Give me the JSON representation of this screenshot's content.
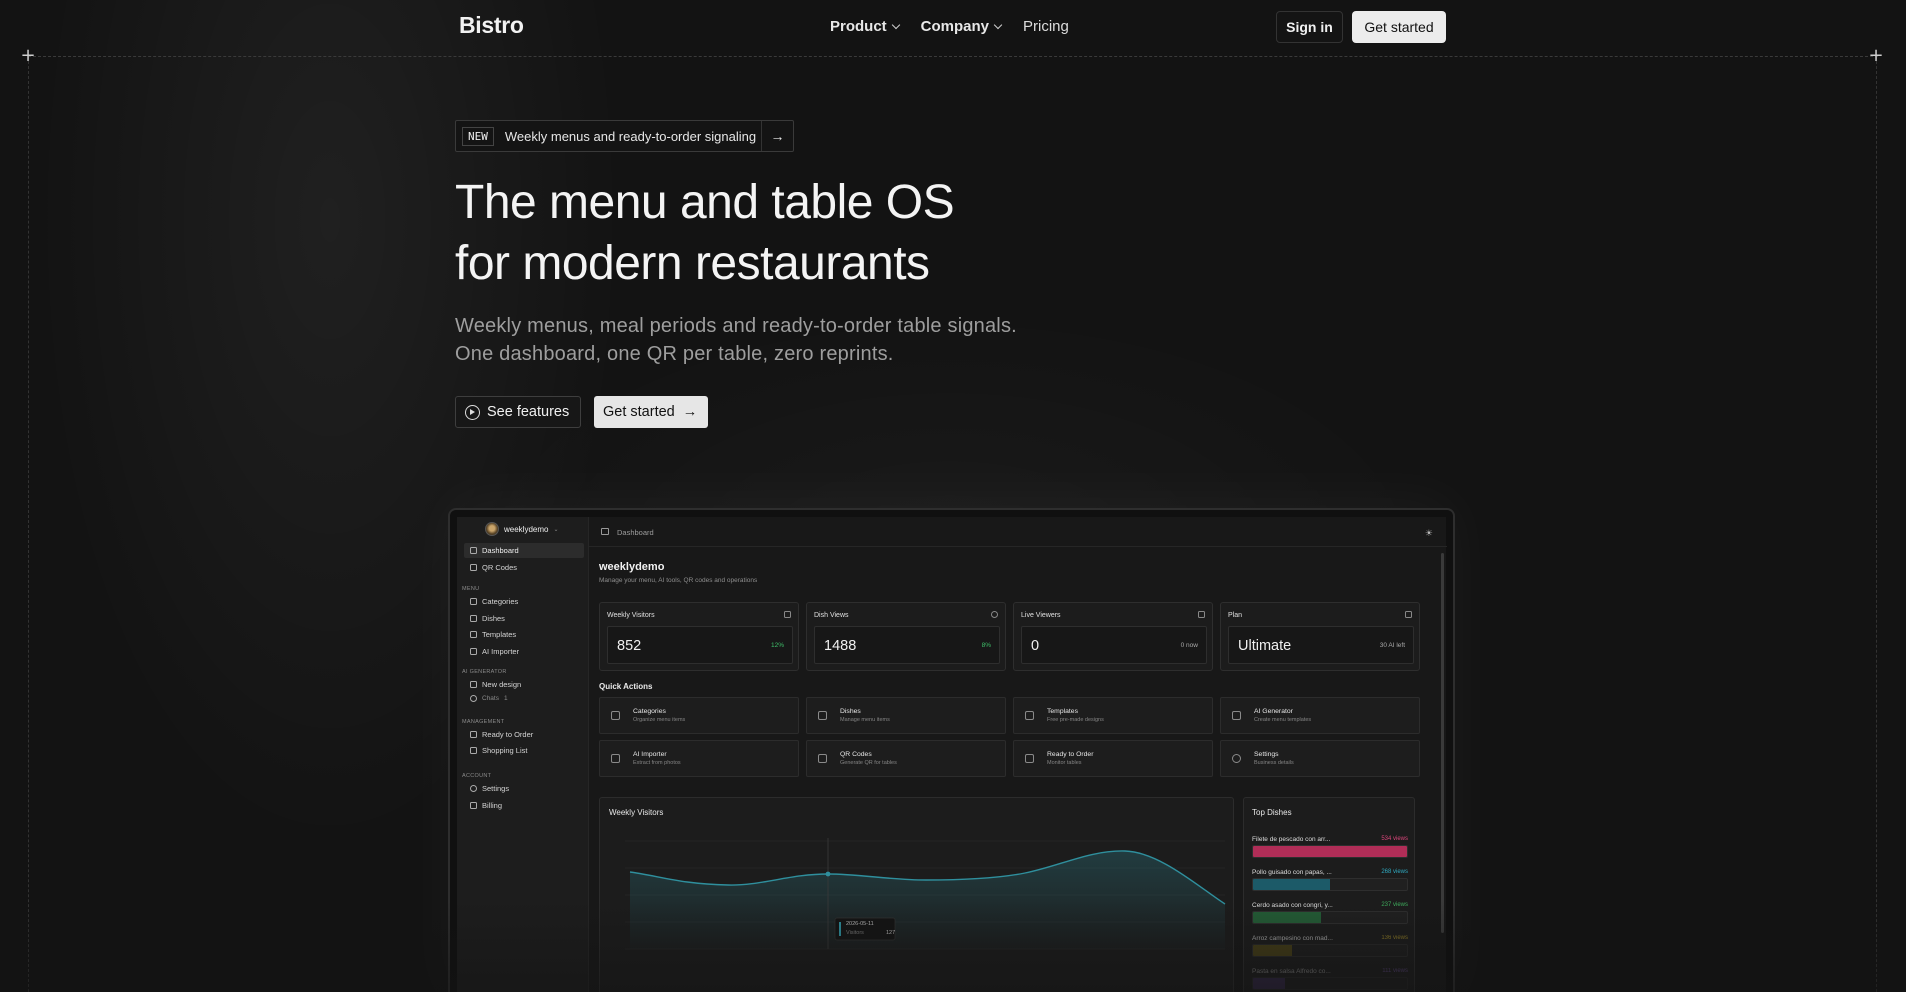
{
  "nav": {
    "logo": "Bistro",
    "links": [
      {
        "label": "Product",
        "dropdown": true
      },
      {
        "label": "Company",
        "dropdown": true
      },
      {
        "label": "Pricing",
        "dropdown": false
      }
    ],
    "sign_in": "Sign in",
    "get_started": "Get started"
  },
  "announcement": {
    "tag": "NEW",
    "text": "Weekly menus and ready-to-order signaling",
    "arrow": "→"
  },
  "hero": {
    "title_line1": "The menu and table OS",
    "title_line2": "for modern restaurants",
    "sub_line1": "Weekly menus, meal periods and ready-to-order table signals.",
    "sub_line2": "One dashboard, one QR per table, zero reprints.",
    "see_features": "See features",
    "get_started": "Get started",
    "get_started_arrow": "→"
  },
  "preview": {
    "workspace": "weeklydemo",
    "sidebar": {
      "items_top": [
        {
          "label": "Dashboard",
          "icon": "home-icon",
          "active": true
        },
        {
          "label": "QR Codes",
          "icon": "qr-icon",
          "active": false
        }
      ],
      "section_menu": "MENU",
      "items_menu": [
        {
          "label": "Categories",
          "icon": "grid-icon"
        },
        {
          "label": "Dishes",
          "icon": "utensils-icon"
        },
        {
          "label": "Templates",
          "icon": "layers-icon"
        },
        {
          "label": "AI Importer",
          "icon": "upload-icon"
        }
      ],
      "section_ai": "AI GENERATOR",
      "items_ai": [
        {
          "label": "New design",
          "icon": "wand-icon"
        },
        {
          "label": "Chats",
          "icon": "clock-icon",
          "count": "1"
        }
      ],
      "section_management": "MANAGEMENT",
      "items_management": [
        {
          "label": "Ready to Order",
          "icon": "bell-icon"
        },
        {
          "label": "Shopping List",
          "icon": "cart-icon"
        }
      ],
      "section_account": "ACCOUNT",
      "items_account": [
        {
          "label": "Settings",
          "icon": "gear-icon"
        },
        {
          "label": "Billing",
          "icon": "card-icon"
        }
      ]
    },
    "breadcrumb": "Dashboard",
    "title": "weeklydemo",
    "subtitle": "Manage your menu, AI tools, QR codes and operations",
    "stats": [
      {
        "label": "Weekly Visitors",
        "value": "852",
        "delta": "12%",
        "delta_color": "#3fbf6a"
      },
      {
        "label": "Dish Views",
        "value": "1488",
        "delta": "8%",
        "delta_color": "#3fbf6a"
      },
      {
        "label": "Live Viewers",
        "value": "0",
        "delta": "0 now",
        "delta_color": "#aaaaaa"
      },
      {
        "label": "Plan",
        "value": "Ultimate",
        "delta": "30 AI left",
        "delta_color": "#aaaaaa"
      }
    ],
    "quick_actions_title": "Quick Actions",
    "quick_actions": [
      {
        "name": "Categories",
        "desc": "Organize menu items"
      },
      {
        "name": "Dishes",
        "desc": "Manage menu items"
      },
      {
        "name": "Templates",
        "desc": "Free pre-made designs"
      },
      {
        "name": "AI Generator",
        "desc": "Create menu templates"
      },
      {
        "name": "AI Importer",
        "desc": "Extract from photos"
      },
      {
        "name": "QR Codes",
        "desc": "Generate QR for tables"
      },
      {
        "name": "Ready to Order",
        "desc": "Monitor tables"
      },
      {
        "name": "Settings",
        "desc": "Business details"
      }
    ],
    "chart_title": "Weekly Visitors",
    "tooltip": {
      "date": "2026-05-11",
      "label": "Visitors",
      "value": "127"
    },
    "chart_color": "#2f8f9d",
    "top_dishes_title": "Top Dishes",
    "top_dishes": [
      {
        "name": "Filete de pescado con arr...",
        "views": "534 views",
        "fraction": 1.0,
        "color": "#c2335f"
      },
      {
        "name": "Pollo guisado con papas, ...",
        "views": "268 views",
        "fraction": 0.5,
        "color": "#1f6e80"
      },
      {
        "name": "Cerdo asado con congri, y...",
        "views": "237 views",
        "fraction": 0.44,
        "color": "#2e7a43"
      },
      {
        "name": "Arroz campesino con mad...",
        "views": "136 views",
        "fraction": 0.25,
        "color": "#7a6a1e"
      },
      {
        "name": "Pasta en salsa Alfredo co...",
        "views": "111 views",
        "fraction": 0.21,
        "color": "#6a4a9a"
      }
    ]
  }
}
